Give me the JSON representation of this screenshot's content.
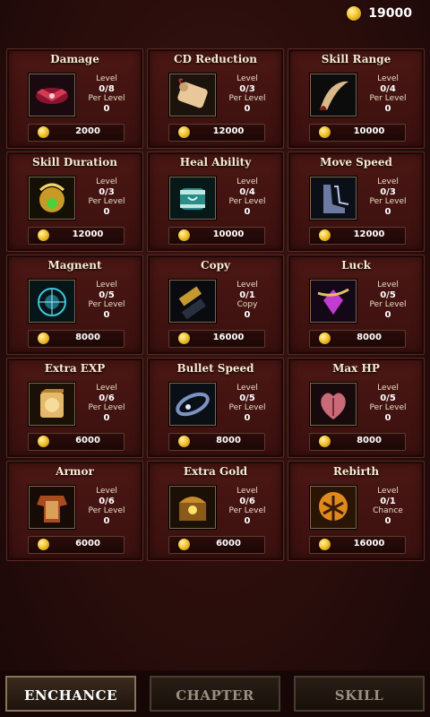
{
  "gold": "19000",
  "cards": [
    {
      "title": "Damage",
      "icon": "damage-icon",
      "stats": [
        "Level",
        "0/8",
        "Per Level",
        "0"
      ],
      "price": "2000"
    },
    {
      "title": "CD Reduction",
      "icon": "cd-reduction-icon",
      "stats": [
        "Level",
        "0/3",
        "Per Level",
        "0"
      ],
      "price": "12000"
    },
    {
      "title": "Skill Range",
      "icon": "skill-range-icon",
      "stats": [
        "Level",
        "0/4",
        "Per Level",
        "0"
      ],
      "price": "10000"
    },
    {
      "title": "Skill Duration",
      "icon": "skill-duration-icon",
      "stats": [
        "Level",
        "0/3",
        "Per Level",
        "0"
      ],
      "price": "12000"
    },
    {
      "title": "Heal Ability",
      "icon": "heal-ability-icon",
      "stats": [
        "Level",
        "0/4",
        "Per Level",
        "0"
      ],
      "price": "10000"
    },
    {
      "title": "Move Speed",
      "icon": "move-speed-icon",
      "stats": [
        "Level",
        "0/3",
        "Per Level",
        "0"
      ],
      "price": "12000"
    },
    {
      "title": "Magnent",
      "icon": "magnet-icon",
      "stats": [
        "Level",
        "0/5",
        "Per Level",
        "0"
      ],
      "price": "8000"
    },
    {
      "title": "Copy",
      "icon": "copy-icon",
      "stats": [
        "Level",
        "0/1",
        "Copy",
        "0"
      ],
      "price": "16000"
    },
    {
      "title": "Luck",
      "icon": "luck-icon",
      "stats": [
        "Level",
        "0/5",
        "Per Level",
        "0"
      ],
      "price": "8000"
    },
    {
      "title": "Extra EXP",
      "icon": "extra-exp-icon",
      "stats": [
        "Level",
        "0/6",
        "Per Level",
        "0"
      ],
      "price": "6000"
    },
    {
      "title": "Bullet Speed",
      "icon": "bullet-speed-icon",
      "stats": [
        "Level",
        "0/5",
        "Per Level",
        "0"
      ],
      "price": "8000"
    },
    {
      "title": "Max HP",
      "icon": "max-hp-icon",
      "stats": [
        "Level",
        "0/5",
        "Per Level",
        "0"
      ],
      "price": "8000"
    },
    {
      "title": "Armor",
      "icon": "armor-icon",
      "stats": [
        "Level",
        "0/6",
        "Per Level",
        "0"
      ],
      "price": "6000"
    },
    {
      "title": "Extra Gold",
      "icon": "extra-gold-icon",
      "stats": [
        "Level",
        "0/6",
        "Per Level",
        "0"
      ],
      "price": "6000"
    },
    {
      "title": "Rebirth",
      "icon": "rebirth-icon",
      "stats": [
        "Level",
        "0/1",
        "Chance",
        "0"
      ],
      "price": "16000"
    }
  ],
  "tabs": {
    "enchance": "ENCHANCE",
    "chapter": "CHAPTER",
    "skill": "SKILL"
  }
}
